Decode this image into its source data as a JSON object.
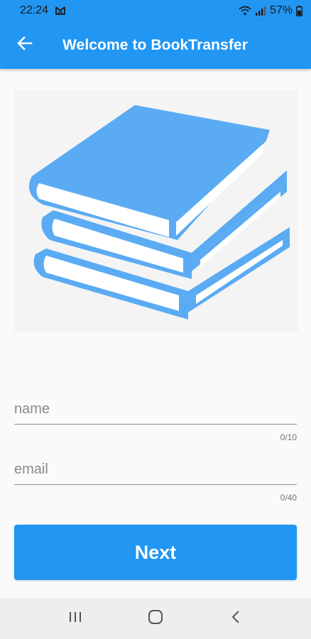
{
  "status_bar": {
    "time": "22:24",
    "battery": "57%",
    "icons": [
      "notification-icon",
      "wifi-icon",
      "signal-icon",
      "battery-icon"
    ]
  },
  "app_bar": {
    "title": "Welcome to BookTransfer",
    "back_icon": "arrow-back-icon"
  },
  "hero": {
    "icon": "books-stack-icon"
  },
  "form": {
    "name": {
      "placeholder": "name",
      "value": "",
      "counter": "0/10"
    },
    "email": {
      "placeholder": "email",
      "value": "",
      "counter": "0/40"
    }
  },
  "next_label": "Next",
  "nav_bar": {
    "icons": [
      "recent-apps-icon",
      "home-icon",
      "back-icon"
    ]
  },
  "colors": {
    "primary": "#2196f3",
    "book_icon": "#5aabf3",
    "background": "#fafafa"
  }
}
